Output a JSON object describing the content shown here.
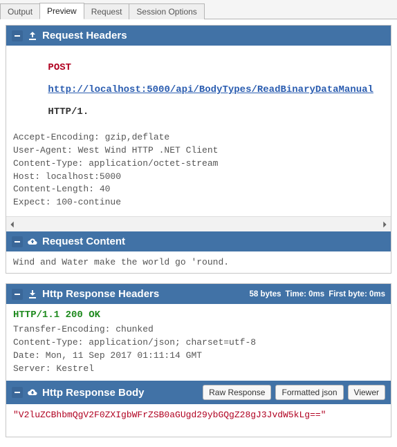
{
  "tabs": {
    "output": "Output",
    "preview": "Preview",
    "request": "Request",
    "session": "Session Options"
  },
  "request_headers": {
    "title": "Request Headers",
    "method": "POST",
    "url": "http://localhost:5000/api/BodyTypes/ReadBinaryDataManual",
    "protocol": "HTTP/1.",
    "lines": "Accept-Encoding: gzip,deflate\nUser-Agent: West Wind HTTP .NET Client\nContent-Type: application/octet-stream\nHost: localhost:5000\nContent-Length: 40\nExpect: 100-continue"
  },
  "request_content": {
    "title": "Request Content",
    "body": "Wind and Water make the world go 'round."
  },
  "response_headers": {
    "title": "Http Response Headers",
    "meta_bytes": "58 bytes",
    "meta_time": "Time: 0ms",
    "meta_first": "First byte: 0ms",
    "status": "HTTP/1.1 200 OK",
    "lines": "Transfer-Encoding: chunked\nContent-Type: application/json; charset=utf-8\nDate: Mon, 11 Sep 2017 01:11:14 GMT\nServer: Kestrel"
  },
  "response_body": {
    "title": "Http Response Body",
    "btn_raw": "Raw Response",
    "btn_fmt": "Formatted json",
    "btn_view": "Viewer",
    "body": "\"V2luZCBhbmQgV2F0ZXIgbWFrZSB0aGUgd29ybGQgZ28gJ3JvdW5kLg==\""
  }
}
